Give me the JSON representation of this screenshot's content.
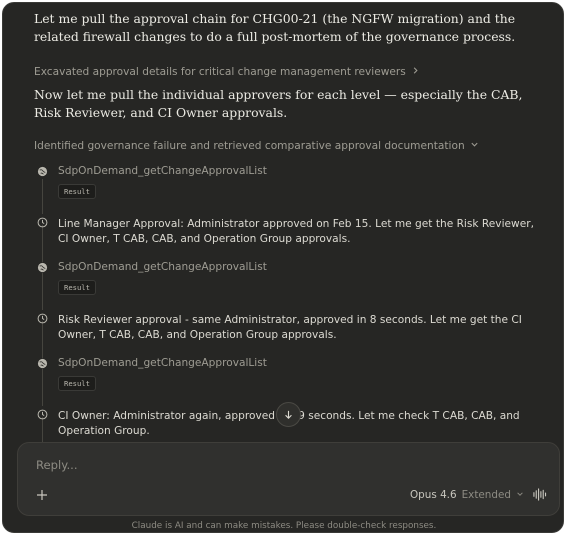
{
  "conversation": {
    "intro_text": "Let me pull the approval chain for CHG00-21 (the NGFW migration) and the related firewall changes to do a full post-mortem of the governance process.",
    "collapsed_1": "Excavated approval details for critical change management reviewers",
    "paragraph_2": "Now let me pull the individual approvers for each level — especially the CAB, Risk Reviewer, and CI Owner approvals.",
    "collapsed_2": "Identified governance failure and retrieved comparative approval documentation",
    "steps": [
      {
        "kind": "tool",
        "name": "SdpOnDemand_getChangeApprovalList",
        "badge": "Result",
        "icon": "globe-icon"
      },
      {
        "kind": "thought",
        "text": "Line Manager Approval: Administrator approved on Feb 15. Let me get the Risk Reviewer, CI Owner, T CAB, CAB, and Operation Group approvals.",
        "icon": "clock-icon"
      },
      {
        "kind": "tool",
        "name": "SdpOnDemand_getChangeApprovalList",
        "badge": "Result",
        "icon": "globe-icon"
      },
      {
        "kind": "thought",
        "text": "Risk Reviewer approval - same Administrator, approved in 8 seconds. Let me get the CI Owner, T CAB, CAB, and Operation Group approvals.",
        "icon": "clock-icon"
      },
      {
        "kind": "tool",
        "name": "SdpOnDemand_getChangeApprovalList",
        "badge": "Result",
        "icon": "globe-icon"
      },
      {
        "kind": "thought",
        "text": "CI Owner: Administrator again, approved in 49 seconds. Let me check T CAB, CAB, and Operation Group.",
        "icon": "clock-icon"
      }
    ]
  },
  "composer": {
    "placeholder": "Reply...",
    "model_name": "Opus 4.6",
    "model_mode": "Extended"
  },
  "footer": {
    "disclaimer": "Claude is AI and can make mistakes. Please double-check responses."
  },
  "colors": {
    "background": "#262624",
    "composer": "#30302e",
    "text": "#ecebe4",
    "muted": "#9e9c93"
  }
}
